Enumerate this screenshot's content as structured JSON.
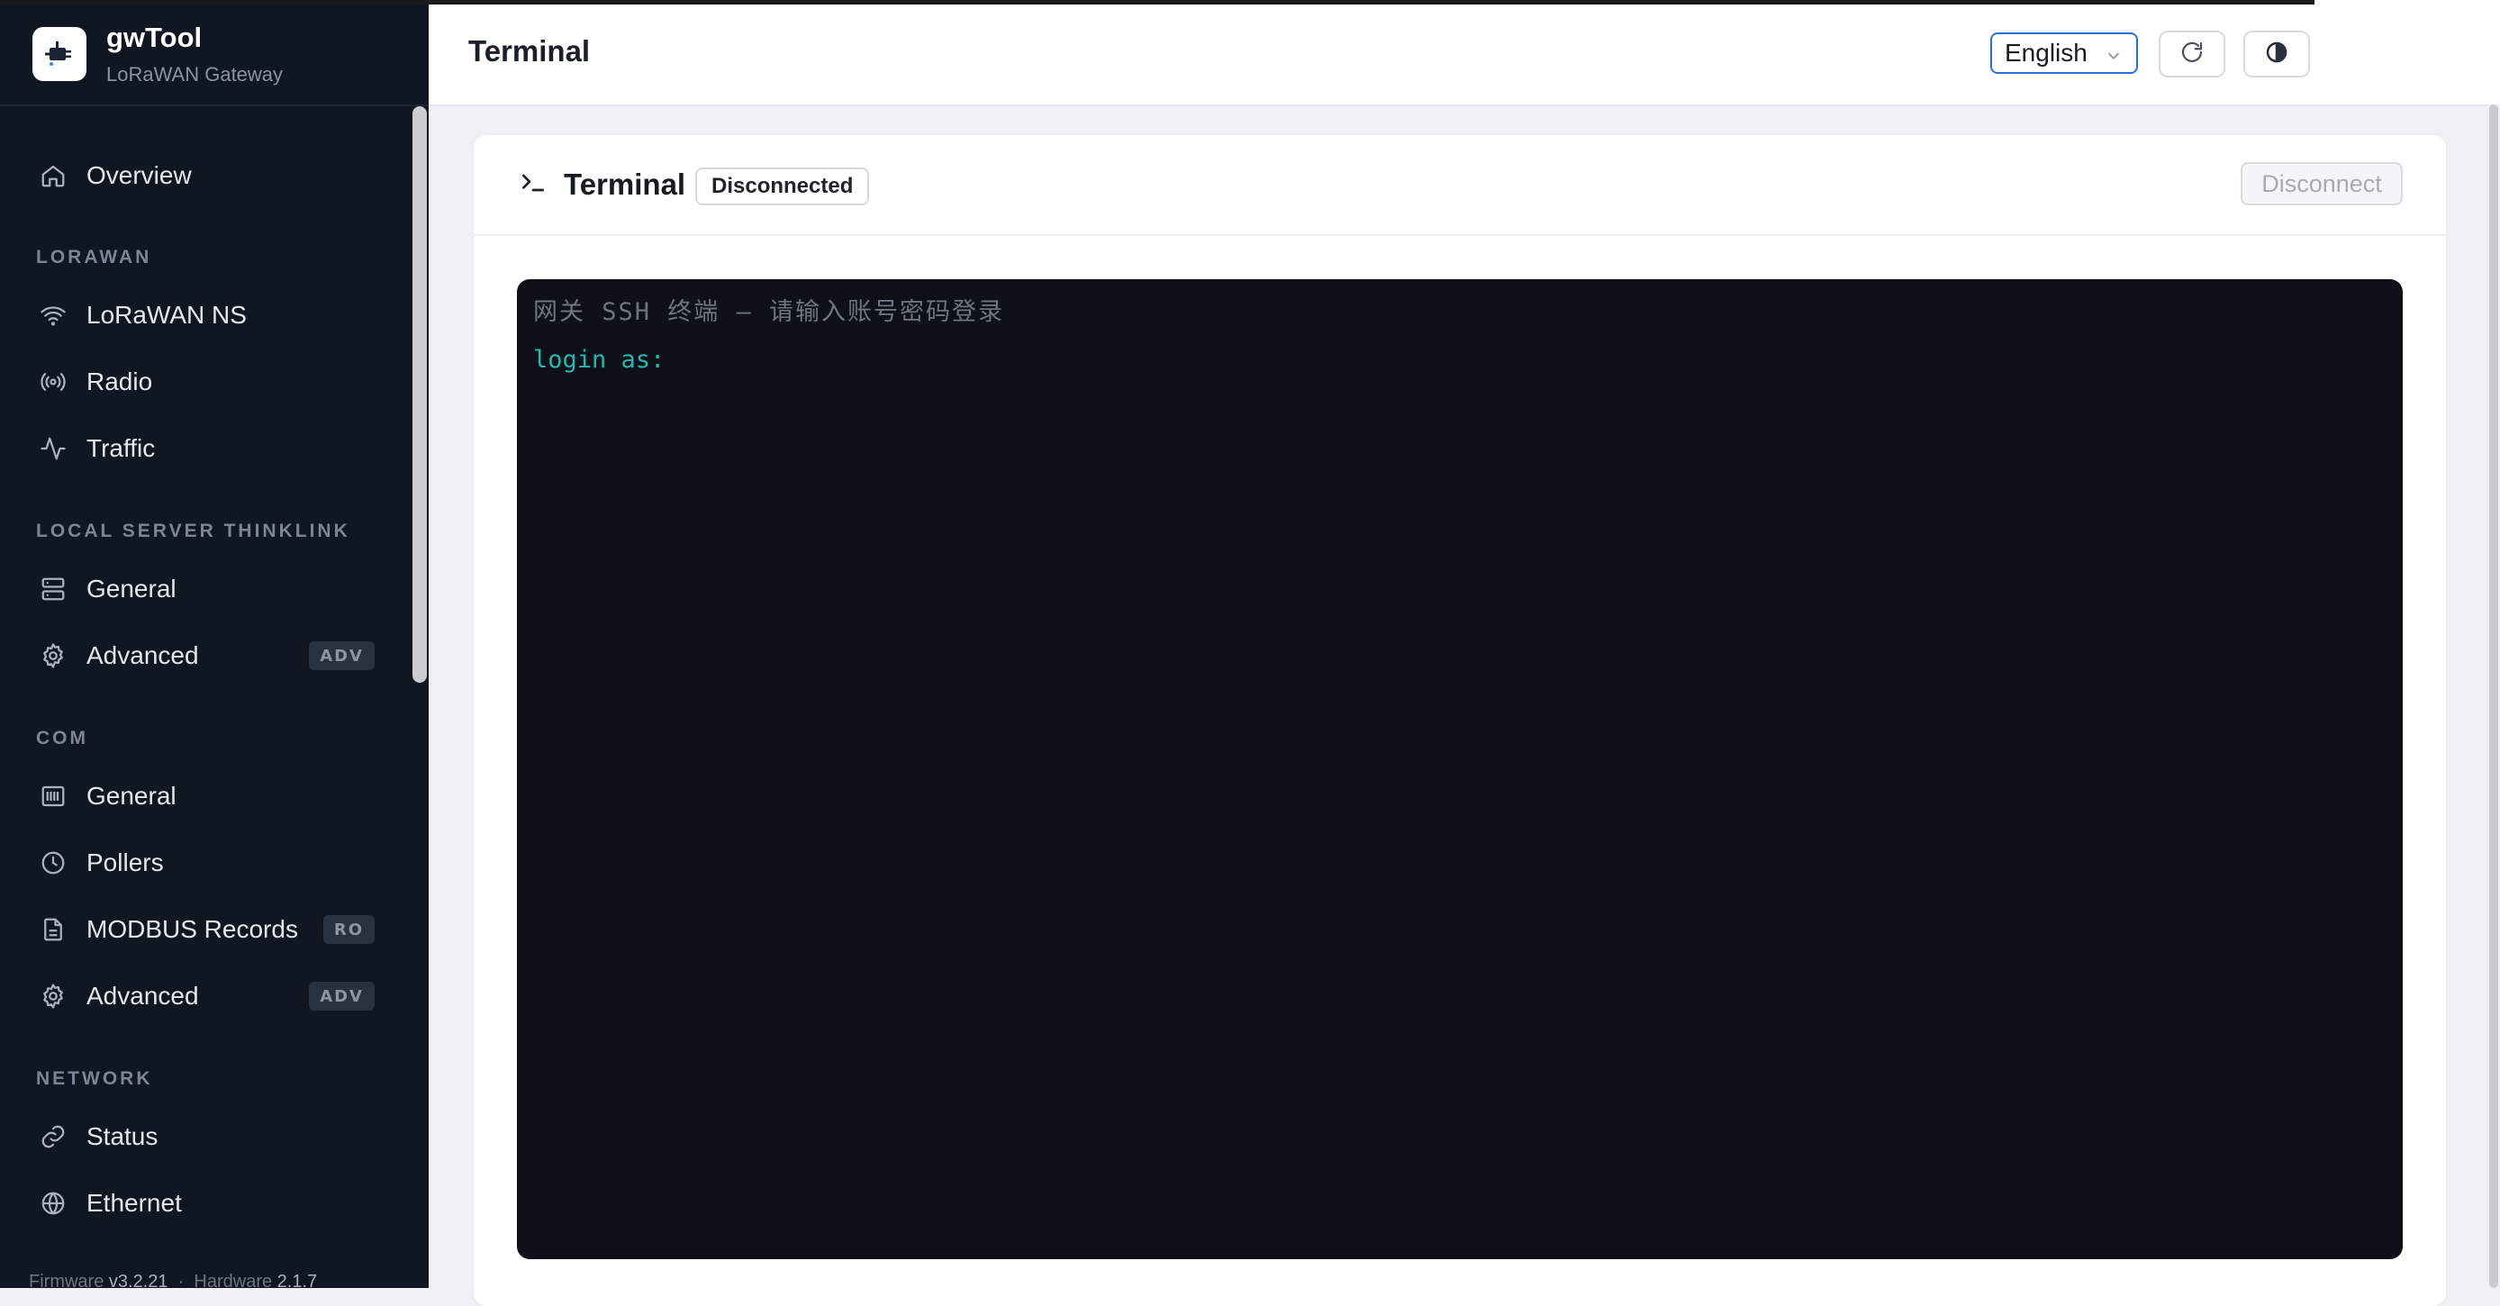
{
  "app": {
    "name": "gwTool",
    "subtitle": "LoRaWAN Gateway"
  },
  "sidebar": {
    "overview": {
      "label": "Overview",
      "icon": "home-icon"
    },
    "sections": {
      "lorawan": "LORAWAN",
      "local_server": "LOCAL SERVER THINKLINK",
      "com": "COM",
      "network": "NETWORK"
    },
    "lorawan_items": [
      {
        "label": "LoRaWAN NS",
        "icon": "wifi-icon"
      },
      {
        "label": "Radio",
        "icon": "radio-icon"
      },
      {
        "label": "Traffic",
        "icon": "activity-icon"
      }
    ],
    "local_server_items": [
      {
        "label": "General",
        "icon": "server-icon"
      },
      {
        "label": "Advanced",
        "icon": "gear-icon",
        "badge": "ADV"
      }
    ],
    "com_items": [
      {
        "label": "General",
        "icon": "serial-port-icon"
      },
      {
        "label": "Pollers",
        "icon": "clock-icon"
      },
      {
        "label": "MODBUS Records",
        "icon": "document-icon",
        "badge": "RO"
      },
      {
        "label": "Advanced",
        "icon": "gear-icon",
        "badge": "ADV"
      }
    ],
    "network_items": [
      {
        "label": "Status",
        "icon": "link-icon"
      },
      {
        "label": "Ethernet",
        "icon": "globe-icon"
      }
    ],
    "footer": {
      "firmware_label": "Firmware",
      "firmware_value": "v3.2.21",
      "hardware_label": "Hardware",
      "hardware_value": "2.1.7"
    }
  },
  "header": {
    "title": "Terminal",
    "language": "English"
  },
  "terminal_card": {
    "title": "Terminal",
    "status": "Disconnected",
    "disconnect_label": "Disconnect",
    "lines": [
      "网关 SSH 终端 — 请输入账号密码登录",
      "login as:"
    ]
  },
  "colors": {
    "sidebar_bg": "#111722",
    "accent": "#2f6fdb",
    "terminal_bg": "#0e1117",
    "prompt_color": "#28b5b0"
  }
}
